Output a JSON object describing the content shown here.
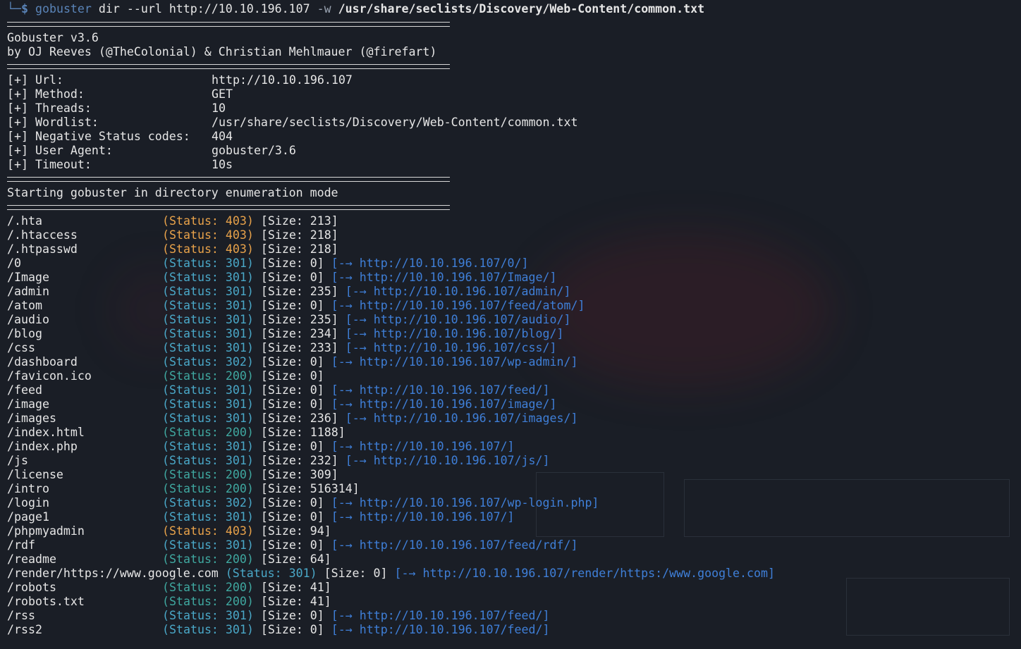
{
  "prompt": {
    "corner": "└─",
    "dollar": "$",
    "command": "gobuster",
    "args": " dir --url http://10.10.196.107 ",
    "flag": "-w",
    "wordlist": "/usr/share/seclists/Discovery/Web-Content/common.txt"
  },
  "banner": {
    "version": "Gobuster v3.6",
    "authors": "by OJ Reeves (@TheColonial) & Christian Mehlmauer (@firefart)"
  },
  "config": [
    {
      "key": "[+] Url:",
      "value": "http://10.10.196.107"
    },
    {
      "key": "[+] Method:",
      "value": "GET"
    },
    {
      "key": "[+] Threads:",
      "value": "10"
    },
    {
      "key": "[+] Wordlist:",
      "value": "/usr/share/seclists/Discovery/Web-Content/common.txt"
    },
    {
      "key": "[+] Negative Status codes:",
      "value": "404"
    },
    {
      "key": "[+] User Agent:",
      "value": "gobuster/3.6"
    },
    {
      "key": "[+] Timeout:",
      "value": "10s"
    }
  ],
  "start_message": "Starting gobuster in directory enumeration mode",
  "results": [
    {
      "path": "/.hta",
      "status": "(Status: 403)",
      "code": "403",
      "size": "[Size: 213]",
      "redirect": ""
    },
    {
      "path": "/.htaccess",
      "status": "(Status: 403)",
      "code": "403",
      "size": "[Size: 218]",
      "redirect": ""
    },
    {
      "path": "/.htpasswd",
      "status": "(Status: 403)",
      "code": "403",
      "size": "[Size: 218]",
      "redirect": ""
    },
    {
      "path": "/0",
      "status": "(Status: 301)",
      "code": "301",
      "size": "[Size: 0]",
      "redirect": "[-→ http://10.10.196.107/0/]"
    },
    {
      "path": "/Image",
      "status": "(Status: 301)",
      "code": "301",
      "size": "[Size: 0]",
      "redirect": "[-→ http://10.10.196.107/Image/]"
    },
    {
      "path": "/admin",
      "status": "(Status: 301)",
      "code": "301",
      "size": "[Size: 235]",
      "redirect": "[-→ http://10.10.196.107/admin/]"
    },
    {
      "path": "/atom",
      "status": "(Status: 301)",
      "code": "301",
      "size": "[Size: 0]",
      "redirect": "[-→ http://10.10.196.107/feed/atom/]"
    },
    {
      "path": "/audio",
      "status": "(Status: 301)",
      "code": "301",
      "size": "[Size: 235]",
      "redirect": "[-→ http://10.10.196.107/audio/]"
    },
    {
      "path": "/blog",
      "status": "(Status: 301)",
      "code": "301",
      "size": "[Size: 234]",
      "redirect": "[-→ http://10.10.196.107/blog/]"
    },
    {
      "path": "/css",
      "status": "(Status: 301)",
      "code": "301",
      "size": "[Size: 233]",
      "redirect": "[-→ http://10.10.196.107/css/]"
    },
    {
      "path": "/dashboard",
      "status": "(Status: 302)",
      "code": "302",
      "size": "[Size: 0]",
      "redirect": "[-→ http://10.10.196.107/wp-admin/]"
    },
    {
      "path": "/favicon.ico",
      "status": "(Status: 200)",
      "code": "200",
      "size": "[Size: 0]",
      "redirect": ""
    },
    {
      "path": "/feed",
      "status": "(Status: 301)",
      "code": "301",
      "size": "[Size: 0]",
      "redirect": "[-→ http://10.10.196.107/feed/]"
    },
    {
      "path": "/image",
      "status": "(Status: 301)",
      "code": "301",
      "size": "[Size: 0]",
      "redirect": "[-→ http://10.10.196.107/image/]"
    },
    {
      "path": "/images",
      "status": "(Status: 301)",
      "code": "301",
      "size": "[Size: 236]",
      "redirect": "[-→ http://10.10.196.107/images/]"
    },
    {
      "path": "/index.html",
      "status": "(Status: 200)",
      "code": "200",
      "size": "[Size: 1188]",
      "redirect": ""
    },
    {
      "path": "/index.php",
      "status": "(Status: 301)",
      "code": "301",
      "size": "[Size: 0]",
      "redirect": "[-→ http://10.10.196.107/]"
    },
    {
      "path": "/js",
      "status": "(Status: 301)",
      "code": "301",
      "size": "[Size: 232]",
      "redirect": "[-→ http://10.10.196.107/js/]"
    },
    {
      "path": "/license",
      "status": "(Status: 200)",
      "code": "200",
      "size": "[Size: 309]",
      "redirect": ""
    },
    {
      "path": "/intro",
      "status": "(Status: 200)",
      "code": "200",
      "size": "[Size: 516314]",
      "redirect": ""
    },
    {
      "path": "/login",
      "status": "(Status: 302)",
      "code": "302",
      "size": "[Size: 0]",
      "redirect": "[-→ http://10.10.196.107/wp-login.php]"
    },
    {
      "path": "/page1",
      "status": "(Status: 301)",
      "code": "301",
      "size": "[Size: 0]",
      "redirect": "[-→ http://10.10.196.107/]"
    },
    {
      "path": "/phpmyadmin",
      "status": "(Status: 403)",
      "code": "403",
      "size": "[Size: 94]",
      "redirect": ""
    },
    {
      "path": "/rdf",
      "status": "(Status: 301)",
      "code": "301",
      "size": "[Size: 0]",
      "redirect": "[-→ http://10.10.196.107/feed/rdf/]"
    },
    {
      "path": "/readme",
      "status": "(Status: 200)",
      "code": "200",
      "size": "[Size: 64]",
      "redirect": ""
    },
    {
      "path": "/render/https://www.google.com",
      "status": "(Status: 301)",
      "code": "301",
      "size": "[Size: 0]",
      "redirect": "[-→ http://10.10.196.107/render/https:/www.google.com]",
      "long": true
    },
    {
      "path": "/robots",
      "status": "(Status: 200)",
      "code": "200",
      "size": "[Size: 41]",
      "redirect": ""
    },
    {
      "path": "/robots.txt",
      "status": "(Status: 200)",
      "code": "200",
      "size": "[Size: 41]",
      "redirect": ""
    },
    {
      "path": "/rss",
      "status": "(Status: 301)",
      "code": "301",
      "size": "[Size: 0]",
      "redirect": "[-→ http://10.10.196.107/feed/]"
    },
    {
      "path": "/rss2",
      "status": "(Status: 301)",
      "code": "301",
      "size": "[Size: 0]",
      "redirect": "[-→ http://10.10.196.107/feed/]"
    }
  ],
  "colors": {
    "background": "#1a1e26",
    "prompt": "#5a84b8",
    "status_403": "#e8a24a",
    "status_301": "#4aa8c8",
    "status_200": "#3fa8a0",
    "redirect": "#3f7fd8"
  }
}
